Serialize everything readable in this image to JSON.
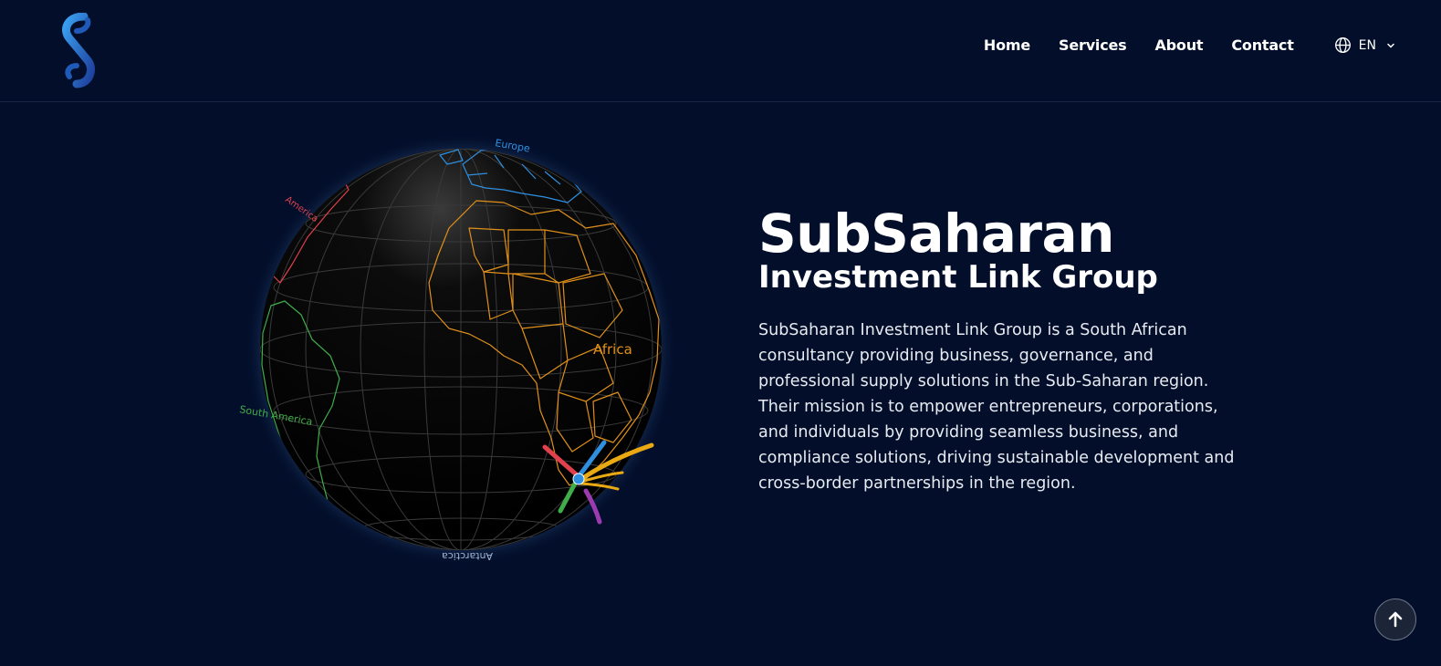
{
  "header": {
    "logo_name": "subsaharan-logo",
    "nav": [
      {
        "label": "Home"
      },
      {
        "label": "Services"
      },
      {
        "label": "About"
      },
      {
        "label": "Contact"
      }
    ],
    "language": {
      "code": "EN",
      "icon": "globe-icon"
    }
  },
  "globe": {
    "labels": {
      "europe": "Europe",
      "africa": "Africa",
      "south_america": "South America",
      "antarctica": "Antarctica",
      "north_america": "America"
    },
    "colors": {
      "africa": "#e0901a",
      "europe": "#2f8fe0",
      "south_america": "#3fae4a",
      "north_america": "#e0414d",
      "arc_purple": "#9b3bb0",
      "arc_yellow": "#e8a913"
    }
  },
  "hero": {
    "title": "SubSaharan",
    "subtitle": "Investment Link Group",
    "description": "SubSaharan Investment Link Group is a South African consultancy providing business, governance, and professional supply solutions in the Sub-Saharan region. Their mission is to empower entrepreneurs, corporations, and individuals by providing seamless business, and compliance solutions, driving sustainable development and cross-border partnerships in the region."
  },
  "scroll_top": {
    "icon": "arrow-up-icon"
  },
  "colors": {
    "background": "#020e2a",
    "text": "#ffffff"
  }
}
